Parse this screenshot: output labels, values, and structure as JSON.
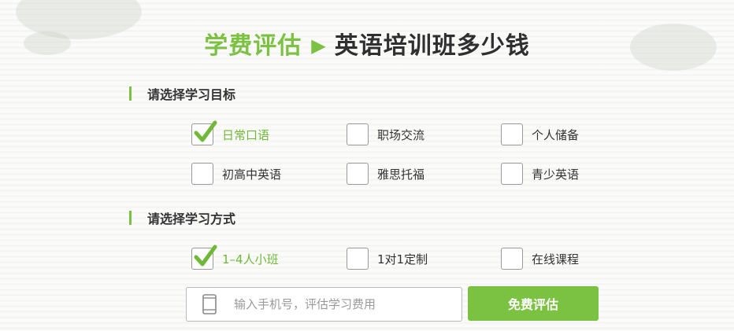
{
  "title": {
    "highlight": "学费评估",
    "arrow": "▶",
    "main": "英语培训班多少钱"
  },
  "goal_section": {
    "heading": "请选择学习目标",
    "options": [
      {
        "label": "日常口语",
        "checked": true
      },
      {
        "label": "职场交流",
        "checked": false
      },
      {
        "label": "个人储备",
        "checked": false
      },
      {
        "label": "初高中英语",
        "checked": false
      },
      {
        "label": "雅思托福",
        "checked": false
      },
      {
        "label": "青少英语",
        "checked": false
      }
    ]
  },
  "method_section": {
    "heading": "请选择学习方式",
    "options": [
      {
        "label": "1–4人小班",
        "checked": true
      },
      {
        "label": "1对1定制",
        "checked": false
      },
      {
        "label": "在线课程",
        "checked": false
      }
    ]
  },
  "phone": {
    "placeholder": "输入手机号，评估学习费用",
    "icon": "mobile-phone-icon"
  },
  "submit": {
    "label": "免费评估"
  },
  "colors": {
    "accent": "#7cc242",
    "text": "#333333",
    "placeholder": "#9a9a9a"
  }
}
